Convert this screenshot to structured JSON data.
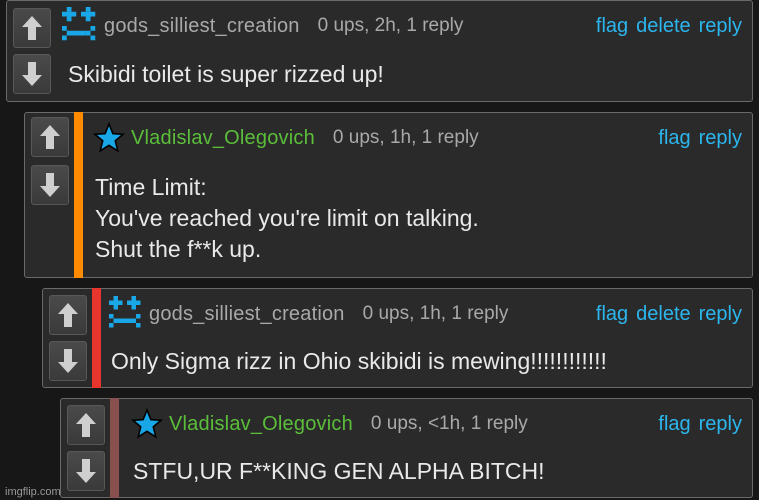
{
  "comments": [
    {
      "username": "gods_silliest_creation",
      "meta": "0 ups, 2h, 1 reply",
      "actions": [
        "flag",
        "delete",
        "reply"
      ],
      "text": "Skibidi toilet is super rizzed up!",
      "avatar": "pixel-avatar-icon",
      "bar_color": null
    },
    {
      "username": "Vladislav_Olegovich",
      "meta": "0 ups, 1h, 1 reply",
      "actions": [
        "flag",
        "reply"
      ],
      "text": "Time Limit:\nYou've reached you're limit on talking.\nShut the f**k up.",
      "avatar": "blue-star-icon",
      "bar_color": "#ff8c00"
    },
    {
      "username": "gods_silliest_creation",
      "meta": "0 ups, 1h, 1 reply",
      "actions": [
        "flag",
        "delete",
        "reply"
      ],
      "text": "Only Sigma rizz in Ohio skibidi is mewing!!!!!!!!!!!!",
      "avatar": "pixel-avatar-icon",
      "bar_color": "#e8352d"
    },
    {
      "username": "Vladislav_Olegovich",
      "meta": "0 ups, <1h, 1 reply",
      "actions": [
        "flag",
        "reply"
      ],
      "text": "STFU,UR F**KING GEN ALPHA BITCH!",
      "avatar": "blue-star-icon",
      "bar_color": "#8a4f4f"
    }
  ],
  "watermark": "imgflip.com",
  "colors": {
    "link": "#2cb6ee",
    "username_green": "#5bbe3a",
    "avatar_blue": "#1aa7e8"
  }
}
